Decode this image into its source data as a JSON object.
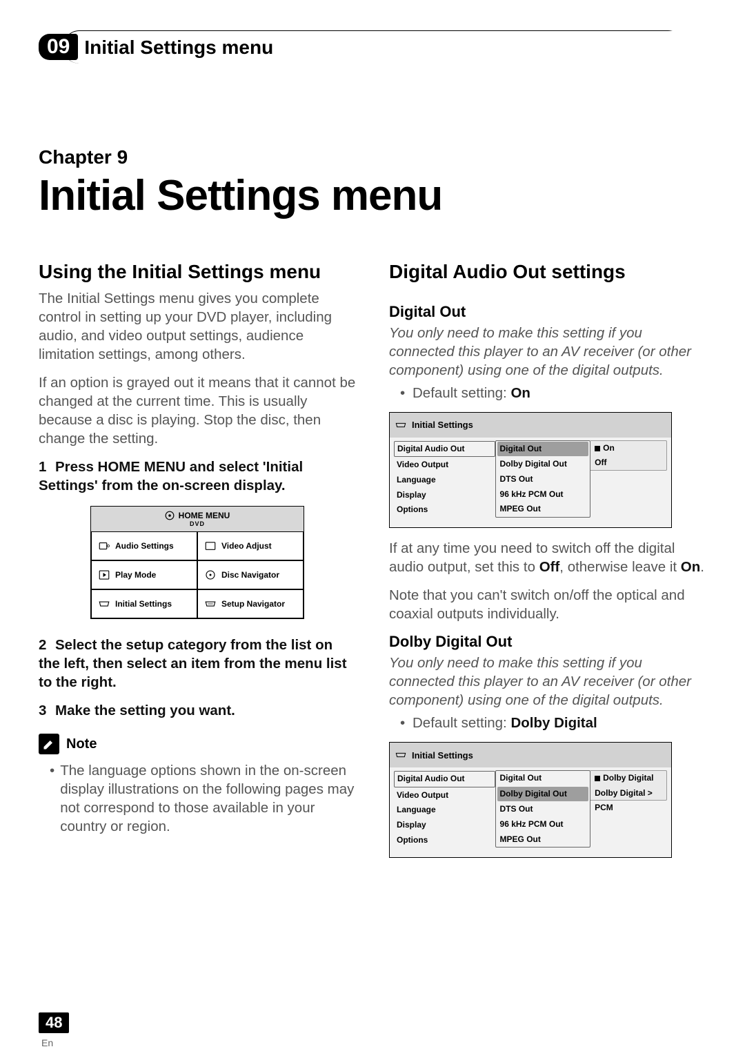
{
  "header": {
    "chapter_num": "09",
    "header_title": "Initial Settings menu"
  },
  "chapter_line": "Chapter 9",
  "page_title": "Initial Settings menu",
  "left": {
    "section_title": "Using the Initial Settings menu",
    "para1": "The Initial Settings menu gives you complete control in setting up your DVD player, including audio, and video output settings, audience limitation settings, among others.",
    "para2": "If an option is grayed out it means that it cannot be changed at the current time. This is usually because a disc is playing. Stop the disc, then change the setting.",
    "step1_num": "1",
    "step1": "Press HOME MENU and select 'Initial Settings' from the on-screen display.",
    "home_menu": {
      "title": "HOME MENU",
      "subtitle": "DVD",
      "cells": [
        "Audio Settings",
        "Video Adjust",
        "Play Mode",
        "Disc Navigator",
        "Initial Settings",
        "Setup Navigator"
      ]
    },
    "step2_num": "2",
    "step2": "Select the setup category from the list on the left, then select an item from the menu list to the right.",
    "step3_num": "3",
    "step3": "Make the setting you want.",
    "note_label": "Note",
    "note_text": "The language options shown in the on-screen display illustrations on the following pages may not correspond to those available in your country or region."
  },
  "right": {
    "section_title": "Digital Audio Out settings",
    "sub1_title": "Digital Out",
    "sub1_italic": "You only need to make this setting if you connected this player to an AV receiver (or other component) using one of the digital outputs.",
    "sub1_default_pre": "Default setting: ",
    "sub1_default_val": "On",
    "shot1": {
      "header": "Initial Settings",
      "col1": [
        "Digital Audio Out",
        "Video Output",
        "Language",
        "Display",
        "Options"
      ],
      "col2": [
        "Digital Out",
        "Dolby Digital Out",
        "DTS Out",
        "96 kHz PCM Out",
        "MPEG Out"
      ],
      "col3": [
        "On",
        "Off"
      ]
    },
    "para_after1a": "If at any time you need to switch off the digital audio output, set this to ",
    "para_after1_off": "Off",
    "para_after1b": ", otherwise leave it ",
    "para_after1_on": "On",
    "para_after1c": ".",
    "para_after2": "Note that you can't switch on/off the optical and coaxial outputs individually.",
    "sub2_title": "Dolby Digital Out",
    "sub2_italic": "You only need to make this setting if you connected this player to an AV receiver (or other component) using one of the digital outputs.",
    "sub2_default_pre": "Default setting: ",
    "sub2_default_val": "Dolby Digital",
    "shot2": {
      "header": "Initial Settings",
      "col1": [
        "Digital Audio Out",
        "Video Output",
        "Language",
        "Display",
        "Options"
      ],
      "col2": [
        "Digital Out",
        "Dolby Digital Out",
        "DTS Out",
        "96 kHz PCM Out",
        "MPEG Out"
      ],
      "col3": [
        "Dolby Digital",
        "Dolby Digital > PCM"
      ]
    }
  },
  "page_number": "48",
  "lang_code": "En"
}
